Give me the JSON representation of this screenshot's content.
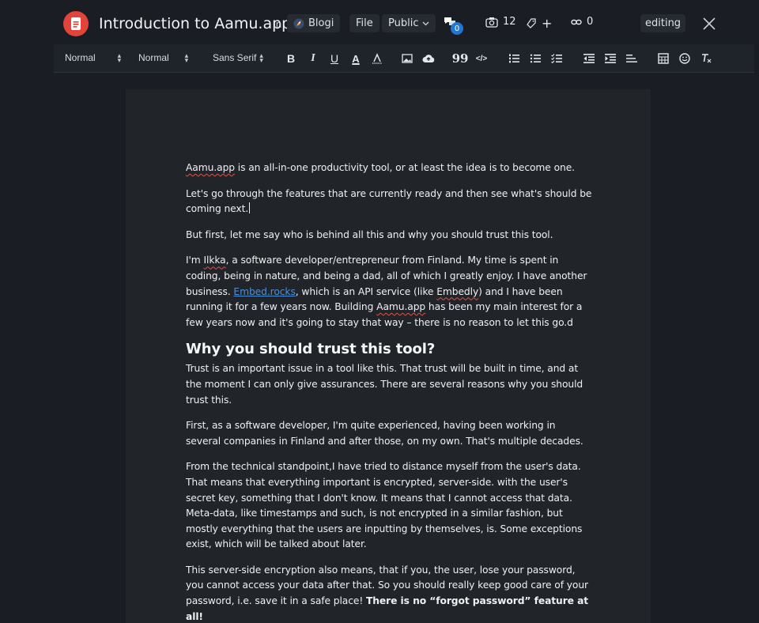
{
  "header": {
    "title": "Introduction to Aamu.app",
    "in_label": "in",
    "blog": "Blogi",
    "file": "File",
    "visibility": "Public",
    "comment_count": "0",
    "image_count": "12",
    "tag_add": "+",
    "link_count": "0",
    "status": "editing"
  },
  "toolbar": {
    "heading_select": "Normal",
    "size_select": "Normal",
    "font_select": "Sans Serif",
    "bold": "B",
    "italic": "I",
    "underline": "U",
    "color": "A",
    "quote": "99",
    "code": "</>"
  },
  "document": {
    "p1_word": "Aamu.app",
    "p1_rest": " is an all-in-one productivity tool, or at least the idea is to become one.",
    "p2": "Let's go through the features that are currently ready and then see what's should be coming next.",
    "p3": "But first, let me say who is behind all this and why you should trust this tool.",
    "p4_a": "I'm ",
    "p4_name": "Ilkka",
    "p4_b": ", a software developer/entrepreneur from Finland. My time is spent in coding, being in nature, and being a dad, all of which I greatly enjoy. I have another business. ",
    "p4_link": "Embed.rocks",
    "p4_c": ", which is an API service (like ",
    "p4_embedly": "Embedly",
    "p4_d": ") and I have been running it for a few years now. Building ",
    "p4_aamu": "Aamu.app",
    "p4_e": " has been my main interest for a few years now and it's going to stay that way – there is no reason to let this go.d",
    "heading": "Why you should trust this tool?",
    "p5": "Trust is an important issue in a tool like this. That trust will be built in time, and at the moment I can only give assurances. There are several reasons why you should trust this.",
    "p6": "First, as a software developer, I'm quite experienced, having been working in several companies in Finland and after those, on my own. That's multiple decades.",
    "p7": "From the technical standpoint,I have tried to distance myself from the user's data. That means that everything important is encrypted, server-side. with the user's secret key, something that I don't know. It means that I cannot access that data. Meta-data, like timestamps and such, is not encrypted in a similar fashion, but mostly everything that the users are inputting by themselves, is. Some exceptions exist, which will be talked about later.",
    "p8_a": "This server-side encryption also means, that if you, the user, lose your password, you cannot access your data after that. So you should really keep good care of your password, i.e. save it in a safe place! ",
    "p8_bold": "There is no “forgot password” feature at all!"
  },
  "colors": {
    "background": "#1a1e24",
    "canvas": "#212529",
    "logo": "#e2433a",
    "badge": "#1f78d1",
    "link": "#4a90d9"
  }
}
